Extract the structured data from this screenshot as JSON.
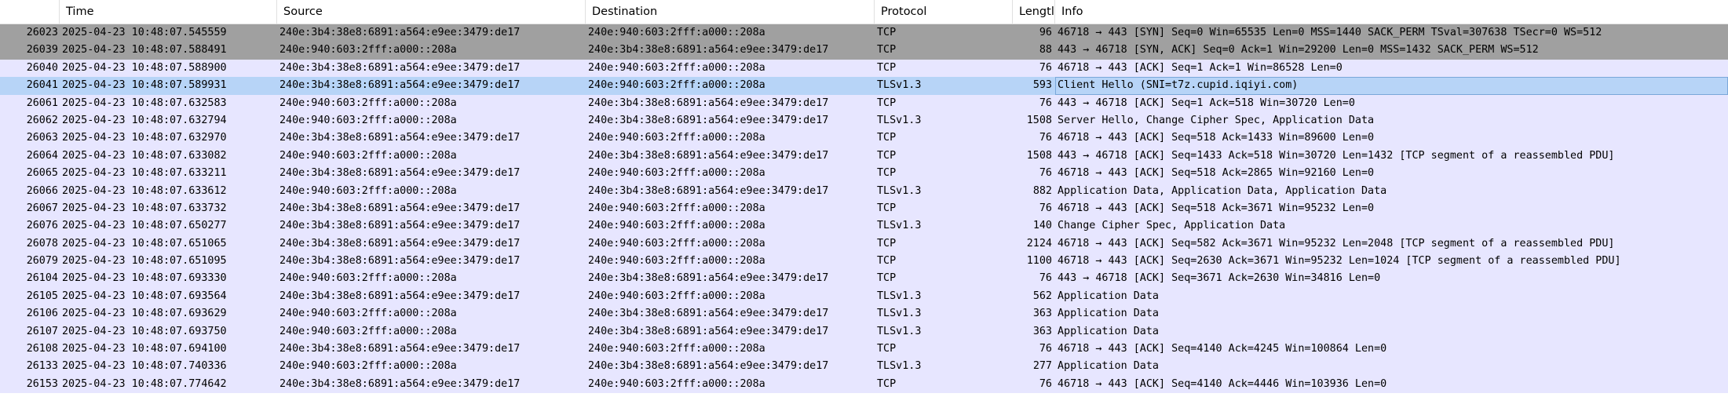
{
  "columns": [
    "",
    "Time",
    "Source",
    "Destination",
    "Protocol",
    "Lengtl",
    "Info"
  ],
  "colors": {
    "syn": "#a0a0a0",
    "tcp": "#e7e6ff",
    "selected": "#b7d4f7"
  },
  "rows": [
    {
      "no": "26023",
      "time": "2025-04-23 10:48:07.545559",
      "src": "240e:3b4:38e8:6891:a564:e9ee:3479:de17",
      "dst": "240e:940:603:2fff:a000::208a",
      "proto": "TCP",
      "len": "96",
      "info": "46718 → 443 [SYN] Seq=0 Win=65535 Len=0 MSS=1440 SACK_PERM TSval=307638 TSecr=0 WS=512",
      "style": "syn"
    },
    {
      "no": "26039",
      "time": "2025-04-23 10:48:07.588491",
      "src": "240e:940:603:2fff:a000::208a",
      "dst": "240e:3b4:38e8:6891:a564:e9ee:3479:de17",
      "proto": "TCP",
      "len": "88",
      "info": "443 → 46718 [SYN, ACK] Seq=0 Ack=1 Win=29200 Len=0 MSS=1432 SACK_PERM WS=512",
      "style": "syn"
    },
    {
      "no": "26040",
      "time": "2025-04-23 10:48:07.588900",
      "src": "240e:3b4:38e8:6891:a564:e9ee:3479:de17",
      "dst": "240e:940:603:2fff:a000::208a",
      "proto": "TCP",
      "len": "76",
      "info": "46718 → 443 [ACK] Seq=1 Ack=1 Win=86528 Len=0",
      "style": "tcp"
    },
    {
      "no": "26041",
      "time": "2025-04-23 10:48:07.589931",
      "src": "240e:3b4:38e8:6891:a564:e9ee:3479:de17",
      "dst": "240e:940:603:2fff:a000::208a",
      "proto": "TLSv1.3",
      "len": "593",
      "info": "Client Hello (SNI=t7z.cupid.iqiyi.com)",
      "style": "selected"
    },
    {
      "no": "26061",
      "time": "2025-04-23 10:48:07.632583",
      "src": "240e:940:603:2fff:a000::208a",
      "dst": "240e:3b4:38e8:6891:a564:e9ee:3479:de17",
      "proto": "TCP",
      "len": "76",
      "info": "443 → 46718 [ACK] Seq=1 Ack=518 Win=30720 Len=0",
      "style": "tcp"
    },
    {
      "no": "26062",
      "time": "2025-04-23 10:48:07.632794",
      "src": "240e:940:603:2fff:a000::208a",
      "dst": "240e:3b4:38e8:6891:a564:e9ee:3479:de17",
      "proto": "TLSv1.3",
      "len": "1508",
      "info": "Server Hello, Change Cipher Spec, Application Data",
      "style": "tcp"
    },
    {
      "no": "26063",
      "time": "2025-04-23 10:48:07.632970",
      "src": "240e:3b4:38e8:6891:a564:e9ee:3479:de17",
      "dst": "240e:940:603:2fff:a000::208a",
      "proto": "TCP",
      "len": "76",
      "info": "46718 → 443 [ACK] Seq=518 Ack=1433 Win=89600 Len=0",
      "style": "tcp"
    },
    {
      "no": "26064",
      "time": "2025-04-23 10:48:07.633082",
      "src": "240e:940:603:2fff:a000::208a",
      "dst": "240e:3b4:38e8:6891:a564:e9ee:3479:de17",
      "proto": "TCP",
      "len": "1508",
      "info": "443 → 46718 [ACK] Seq=1433 Ack=518 Win=30720 Len=1432 [TCP segment of a reassembled PDU]",
      "style": "tcp"
    },
    {
      "no": "26065",
      "time": "2025-04-23 10:48:07.633211",
      "src": "240e:3b4:38e8:6891:a564:e9ee:3479:de17",
      "dst": "240e:940:603:2fff:a000::208a",
      "proto": "TCP",
      "len": "76",
      "info": "46718 → 443 [ACK] Seq=518 Ack=2865 Win=92160 Len=0",
      "style": "tcp"
    },
    {
      "no": "26066",
      "time": "2025-04-23 10:48:07.633612",
      "src": "240e:940:603:2fff:a000::208a",
      "dst": "240e:3b4:38e8:6891:a564:e9ee:3479:de17",
      "proto": "TLSv1.3",
      "len": "882",
      "info": "Application Data, Application Data, Application Data",
      "style": "tcp"
    },
    {
      "no": "26067",
      "time": "2025-04-23 10:48:07.633732",
      "src": "240e:3b4:38e8:6891:a564:e9ee:3479:de17",
      "dst": "240e:940:603:2fff:a000::208a",
      "proto": "TCP",
      "len": "76",
      "info": "46718 → 443 [ACK] Seq=518 Ack=3671 Win=95232 Len=0",
      "style": "tcp"
    },
    {
      "no": "26076",
      "time": "2025-04-23 10:48:07.650277",
      "src": "240e:3b4:38e8:6891:a564:e9ee:3479:de17",
      "dst": "240e:940:603:2fff:a000::208a",
      "proto": "TLSv1.3",
      "len": "140",
      "info": "Change Cipher Spec, Application Data",
      "style": "tcp"
    },
    {
      "no": "26078",
      "time": "2025-04-23 10:48:07.651065",
      "src": "240e:3b4:38e8:6891:a564:e9ee:3479:de17",
      "dst": "240e:940:603:2fff:a000::208a",
      "proto": "TCP",
      "len": "2124",
      "info": "46718 → 443 [ACK] Seq=582 Ack=3671 Win=95232 Len=2048 [TCP segment of a reassembled PDU]",
      "style": "tcp"
    },
    {
      "no": "26079",
      "time": "2025-04-23 10:48:07.651095",
      "src": "240e:3b4:38e8:6891:a564:e9ee:3479:de17",
      "dst": "240e:940:603:2fff:a000::208a",
      "proto": "TCP",
      "len": "1100",
      "info": "46718 → 443 [ACK] Seq=2630 Ack=3671 Win=95232 Len=1024 [TCP segment of a reassembled PDU]",
      "style": "tcp"
    },
    {
      "no": "26104",
      "time": "2025-04-23 10:48:07.693330",
      "src": "240e:940:603:2fff:a000::208a",
      "dst": "240e:3b4:38e8:6891:a564:e9ee:3479:de17",
      "proto": "TCP",
      "len": "76",
      "info": "443 → 46718 [ACK] Seq=3671 Ack=2630 Win=34816 Len=0",
      "style": "tcp"
    },
    {
      "no": "26105",
      "time": "2025-04-23 10:48:07.693564",
      "src": "240e:3b4:38e8:6891:a564:e9ee:3479:de17",
      "dst": "240e:940:603:2fff:a000::208a",
      "proto": "TLSv1.3",
      "len": "562",
      "info": "Application Data",
      "style": "tcp"
    },
    {
      "no": "26106",
      "time": "2025-04-23 10:48:07.693629",
      "src": "240e:940:603:2fff:a000::208a",
      "dst": "240e:3b4:38e8:6891:a564:e9ee:3479:de17",
      "proto": "TLSv1.3",
      "len": "363",
      "info": "Application Data",
      "style": "tcp"
    },
    {
      "no": "26107",
      "time": "2025-04-23 10:48:07.693750",
      "src": "240e:940:603:2fff:a000::208a",
      "dst": "240e:3b4:38e8:6891:a564:e9ee:3479:de17",
      "proto": "TLSv1.3",
      "len": "363",
      "info": "Application Data",
      "style": "tcp"
    },
    {
      "no": "26108",
      "time": "2025-04-23 10:48:07.694100",
      "src": "240e:3b4:38e8:6891:a564:e9ee:3479:de17",
      "dst": "240e:940:603:2fff:a000::208a",
      "proto": "TCP",
      "len": "76",
      "info": "46718 → 443 [ACK] Seq=4140 Ack=4245 Win=100864 Len=0",
      "style": "tcp"
    },
    {
      "no": "26133",
      "time": "2025-04-23 10:48:07.740336",
      "src": "240e:940:603:2fff:a000::208a",
      "dst": "240e:3b4:38e8:6891:a564:e9ee:3479:de17",
      "proto": "TLSv1.3",
      "len": "277",
      "info": "Application Data",
      "style": "tcp"
    },
    {
      "no": "26153",
      "time": "2025-04-23 10:48:07.774642",
      "src": "240e:3b4:38e8:6891:a564:e9ee:3479:de17",
      "dst": "240e:940:603:2fff:a000::208a",
      "proto": "TCP",
      "len": "76",
      "info": "46718 → 443 [ACK] Seq=4140 Ack=4446 Win=103936 Len=0",
      "style": "tcp"
    }
  ]
}
